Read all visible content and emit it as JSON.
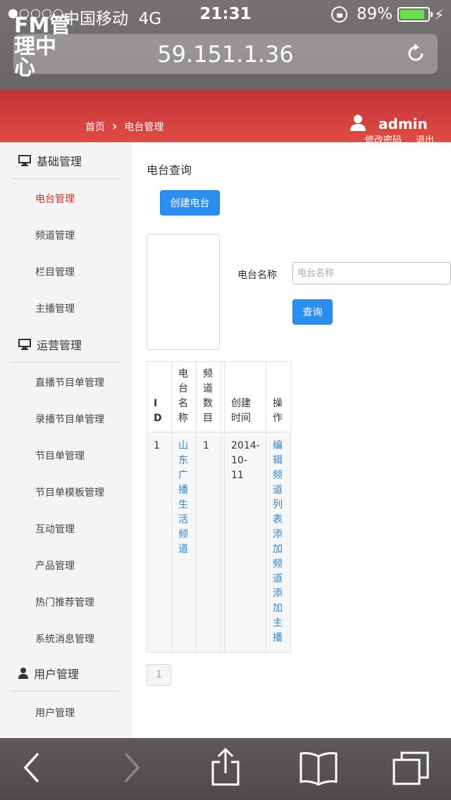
{
  "status_bar": {
    "carrier": "中国移动",
    "network": "4G",
    "time": "21:31",
    "battery_percent": "89%",
    "battery_level": 0.89,
    "icons": [
      "signal-dots",
      "rotation-lock-icon",
      "battery-icon",
      "charging-icon"
    ]
  },
  "browser": {
    "address": "59.151.1.36",
    "toolbar_icons": [
      "back-icon",
      "forward-icon",
      "share-icon",
      "bookmarks-icon",
      "tabs-icon"
    ]
  },
  "header": {
    "logo": "FM管理中心",
    "breadcrumb": [
      "首页",
      "电台管理"
    ],
    "username": "admin",
    "links": [
      "修改密码",
      "退出"
    ],
    "color": "#d63c3c"
  },
  "sidebar": {
    "groups": [
      {
        "title": "基础管理",
        "icon": "monitor-icon",
        "items": [
          "电台管理",
          "频道管理",
          "栏目管理",
          "主播管理"
        ]
      },
      {
        "title": "运营管理",
        "icon": "monitor-icon",
        "items": [
          "直播节目单管理",
          "录播节目单管理",
          "节目单管理",
          "节目单模板管理",
          "互动管理",
          "产品管理",
          "热门推荐管理",
          "系统消息管理"
        ]
      },
      {
        "title": "用户管理",
        "icon": "user-icon",
        "items": [
          "用户管理"
        ]
      }
    ],
    "active_item": "电台管理",
    "active_color": "#c9302c"
  },
  "main": {
    "heading": "电台查询",
    "create_button": "创建电台",
    "search": {
      "label": "电台名称",
      "placeholder": "电台名称",
      "value": ""
    },
    "query_button": "查询",
    "table": {
      "columns": [
        "ID",
        "电台名称",
        "频道数目",
        "创建时间",
        "操作"
      ],
      "rows": [
        {
          "id": "1",
          "name": "山东广播生活频道",
          "channel_count": "1",
          "created": "2014-10-11",
          "actions": [
            "编辑",
            "频道列表",
            "添加频道",
            "添加主播"
          ]
        }
      ]
    },
    "pagination": {
      "pages": [
        "1"
      ],
      "current": "1"
    },
    "button_color": "#2c8ff0",
    "link_color": "#2a86d0"
  }
}
